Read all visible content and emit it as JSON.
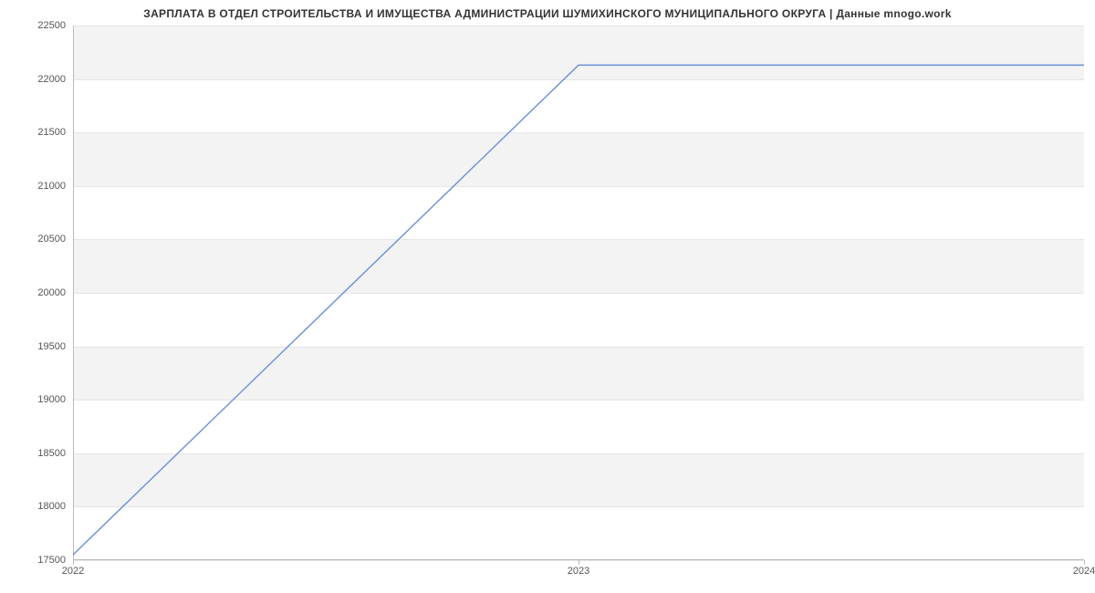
{
  "chart_data": {
    "type": "line",
    "title": "ЗАРПЛАТА В ОТДЕЛ СТРОИТЕЛЬСТВА И ИМУЩЕСТВА АДМИНИСТРАЦИИ ШУМИХИНСКОГО МУНИЦИПАЛЬНОГО ОКРУГА | Данные mnogo.work",
    "xlabel": "",
    "ylabel": "",
    "x": [
      2022,
      2023,
      2024
    ],
    "values": [
      17550,
      22130,
      22130
    ],
    "x_ticks": [
      "2022",
      "2023",
      "2024"
    ],
    "y_ticks": [
      "17500",
      "18000",
      "18500",
      "19000",
      "19500",
      "20000",
      "20500",
      "21000",
      "21500",
      "22000",
      "22500"
    ],
    "ylim": [
      17500,
      22500
    ],
    "xlim": [
      2022,
      2024
    ],
    "line_color": "#6a8fd8"
  }
}
